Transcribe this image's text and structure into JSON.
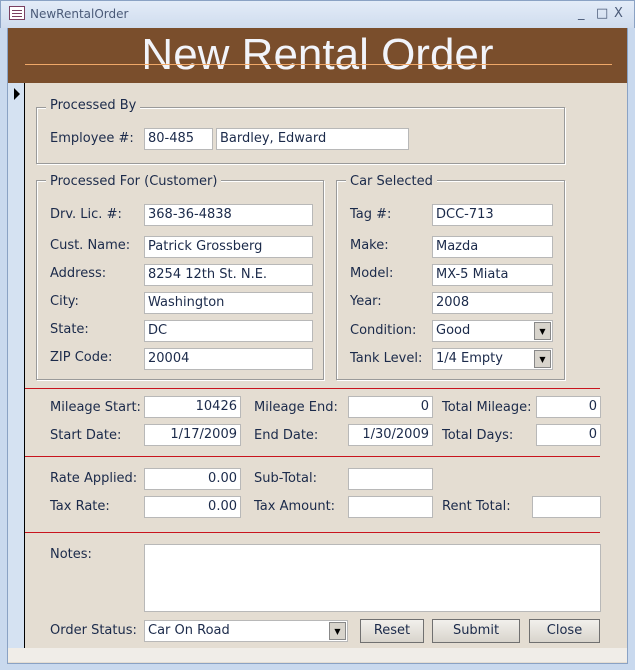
{
  "window": {
    "title": "NewRentalOrder",
    "minimize": "_",
    "maximize": "□",
    "close": "X"
  },
  "header": {
    "title": "New Rental Order"
  },
  "processed_by": {
    "legend": "Processed By",
    "employee_label": "Employee #:",
    "employee_number": "80-485",
    "employee_name": "Bardley, Edward"
  },
  "customer": {
    "legend": "Processed For (Customer)",
    "fields": [
      {
        "label": "Drv. Lic. #:",
        "value": "368-36-4838"
      },
      {
        "label": "Cust. Name:",
        "value": "Patrick Grossberg"
      },
      {
        "label": "Address:",
        "value": "8254 12th St. N.E."
      },
      {
        "label": "City:",
        "value": "Washington"
      },
      {
        "label": "State:",
        "value": "DC"
      },
      {
        "label": "ZIP Code:",
        "value": "20004"
      }
    ]
  },
  "car": {
    "legend": "Car Selected",
    "fields": [
      {
        "label": "Tag #:",
        "value": "DCC-713"
      },
      {
        "label": "Make:",
        "value": "Mazda"
      },
      {
        "label": "Model:",
        "value": "MX-5 Miata"
      },
      {
        "label": "Year:",
        "value": "2008"
      }
    ],
    "condition_label": "Condition:",
    "condition": "Good",
    "tank_label": "Tank Level:",
    "tank": "1/4 Empty"
  },
  "mileage": {
    "start_label": "Mileage Start:",
    "start": "10426",
    "end_label": "Mileage End:",
    "end": "0",
    "total_label": "Total Mileage:",
    "total": "0"
  },
  "dates": {
    "start_label": "Start Date:",
    "start": "1/17/2009",
    "end_label": "End Date:",
    "end": "1/30/2009",
    "days_label": "Total Days:",
    "days": "0"
  },
  "rates": {
    "rate_label": "Rate Applied:",
    "rate": "0.00",
    "subtotal_label": "Sub-Total:",
    "subtotal": "",
    "taxrate_label": "Tax Rate:",
    "taxrate": "0.00",
    "taxamount_label": "Tax Amount:",
    "taxamount": "",
    "renttotal_label": "Rent Total:",
    "renttotal": ""
  },
  "notes": {
    "label": "Notes:",
    "value": ""
  },
  "order_status": {
    "label": "Order Status:",
    "value": "Car On Road"
  },
  "buttons": {
    "reset": "Reset",
    "submit": "Submit",
    "close": "Close"
  },
  "colors": {
    "header_bg": "#7a4e2c",
    "form_bg": "#e4ddd2",
    "separator": "#c8141e"
  }
}
